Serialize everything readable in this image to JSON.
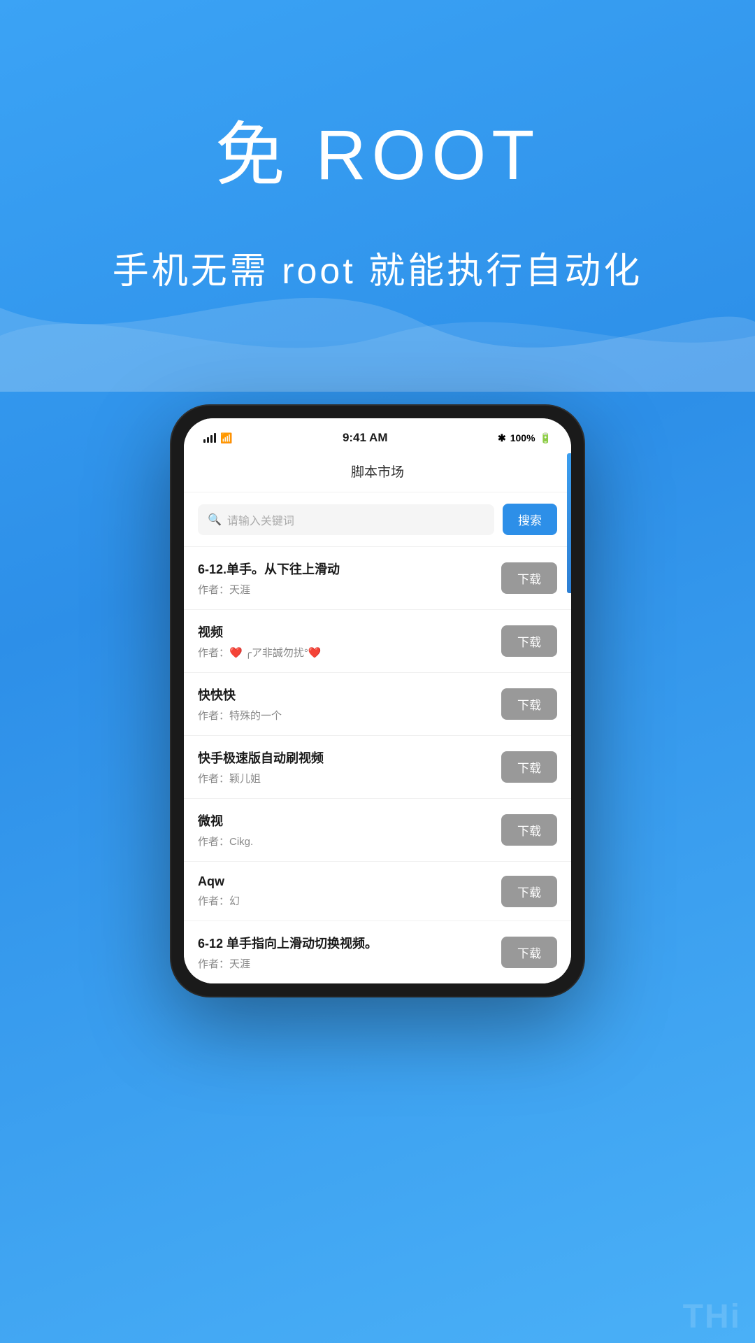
{
  "hero": {
    "title": "免 ROOT",
    "subtitle": "手机无需 root 就能执行自动化"
  },
  "status_bar": {
    "time": "9:41 AM",
    "battery": "100%",
    "bluetooth": "✱"
  },
  "app_header": {
    "title": "脚本市场"
  },
  "search": {
    "placeholder": "请输入关键词",
    "button_label": "搜索"
  },
  "scripts": [
    {
      "name": "6-12.单手。从下往上滑动",
      "author": "作者：天涯",
      "download": "下载"
    },
    {
      "name": "视频",
      "author": "作者：❤️ ╭ア非誠勿扰°❤️",
      "download": "下载"
    },
    {
      "name": "快快快",
      "author": "作者：特殊的一个",
      "download": "下载"
    },
    {
      "name": "快手极速版自动刷视频",
      "author": "作者：颖儿姐",
      "download": "下载"
    },
    {
      "name": "微视",
      "author": "作者：Cikg.",
      "download": "下载"
    },
    {
      "name": "Aqw",
      "author": "作者：幻",
      "download": "下载"
    },
    {
      "name": "6-12 单手指向上滑动切换视频。",
      "author": "作者：天涯",
      "download": "下载"
    }
  ],
  "watermark": {
    "text": "THi"
  }
}
